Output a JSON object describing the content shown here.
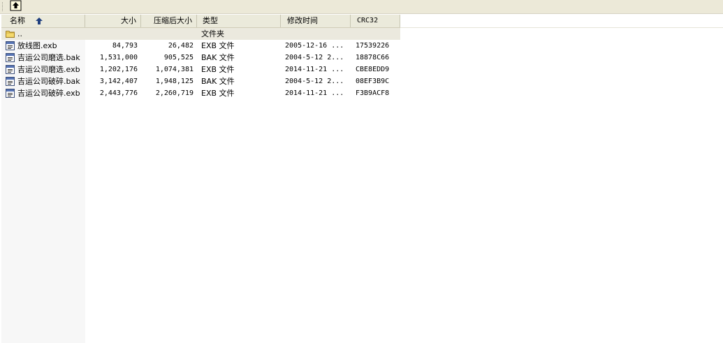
{
  "toolbar": {
    "up_icon": "up-folder-icon"
  },
  "columns": {
    "name": "名称",
    "size": "大小",
    "packed": "压缩后大小",
    "type": "类型",
    "modified": "修改时间",
    "crc": "CRC32"
  },
  "rows": [
    {
      "name": "..",
      "size": "",
      "packed": "",
      "type": "文件夹",
      "modified": "",
      "crc": "",
      "icon": "folder-icon"
    },
    {
      "name": "放线图.exb",
      "size": "84,793",
      "packed": "26,482",
      "type": "EXB 文件",
      "modified": "2005-12-16 ...",
      "crc": "17539226",
      "icon": "document-icon"
    },
    {
      "name": "吉运公司磨选.bak",
      "size": "1,531,000",
      "packed": "905,525",
      "type": "BAK 文件",
      "modified": "2004-5-12 2...",
      "crc": "18878C66",
      "icon": "document-icon"
    },
    {
      "name": "吉运公司磨选.exb",
      "size": "1,202,176",
      "packed": "1,074,381",
      "type": "EXB 文件",
      "modified": "2014-11-21 ...",
      "crc": "CBE8EDD9",
      "icon": "document-icon"
    },
    {
      "name": "吉运公司破碎.bak",
      "size": "3,142,407",
      "packed": "1,948,125",
      "type": "BAK 文件",
      "modified": "2004-5-12 2...",
      "crc": "08EF3B9C",
      "icon": "document-icon"
    },
    {
      "name": "吉运公司破碎.exb",
      "size": "2,443,776",
      "packed": "2,260,719",
      "type": "EXB 文件",
      "modified": "2014-11-21 ...",
      "crc": "F3B9ACF8",
      "icon": "document-icon"
    }
  ]
}
